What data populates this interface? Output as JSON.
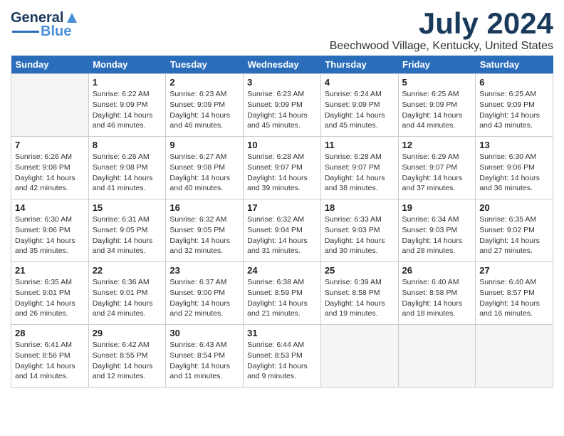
{
  "header": {
    "logo_general": "General",
    "logo_blue": "Blue",
    "month_title": "July 2024",
    "location": "Beechwood Village, Kentucky, United States"
  },
  "weekdays": [
    "Sunday",
    "Monday",
    "Tuesday",
    "Wednesday",
    "Thursday",
    "Friday",
    "Saturday"
  ],
  "weeks": [
    [
      {
        "day": "",
        "info": ""
      },
      {
        "day": "1",
        "info": "Sunrise: 6:22 AM\nSunset: 9:09 PM\nDaylight: 14 hours\nand 46 minutes."
      },
      {
        "day": "2",
        "info": "Sunrise: 6:23 AM\nSunset: 9:09 PM\nDaylight: 14 hours\nand 46 minutes."
      },
      {
        "day": "3",
        "info": "Sunrise: 6:23 AM\nSunset: 9:09 PM\nDaylight: 14 hours\nand 45 minutes."
      },
      {
        "day": "4",
        "info": "Sunrise: 6:24 AM\nSunset: 9:09 PM\nDaylight: 14 hours\nand 45 minutes."
      },
      {
        "day": "5",
        "info": "Sunrise: 6:25 AM\nSunset: 9:09 PM\nDaylight: 14 hours\nand 44 minutes."
      },
      {
        "day": "6",
        "info": "Sunrise: 6:25 AM\nSunset: 9:09 PM\nDaylight: 14 hours\nand 43 minutes."
      }
    ],
    [
      {
        "day": "7",
        "info": "Sunrise: 6:26 AM\nSunset: 9:08 PM\nDaylight: 14 hours\nand 42 minutes."
      },
      {
        "day": "8",
        "info": "Sunrise: 6:26 AM\nSunset: 9:08 PM\nDaylight: 14 hours\nand 41 minutes."
      },
      {
        "day": "9",
        "info": "Sunrise: 6:27 AM\nSunset: 9:08 PM\nDaylight: 14 hours\nand 40 minutes."
      },
      {
        "day": "10",
        "info": "Sunrise: 6:28 AM\nSunset: 9:07 PM\nDaylight: 14 hours\nand 39 minutes."
      },
      {
        "day": "11",
        "info": "Sunrise: 6:28 AM\nSunset: 9:07 PM\nDaylight: 14 hours\nand 38 minutes."
      },
      {
        "day": "12",
        "info": "Sunrise: 6:29 AM\nSunset: 9:07 PM\nDaylight: 14 hours\nand 37 minutes."
      },
      {
        "day": "13",
        "info": "Sunrise: 6:30 AM\nSunset: 9:06 PM\nDaylight: 14 hours\nand 36 minutes."
      }
    ],
    [
      {
        "day": "14",
        "info": "Sunrise: 6:30 AM\nSunset: 9:06 PM\nDaylight: 14 hours\nand 35 minutes."
      },
      {
        "day": "15",
        "info": "Sunrise: 6:31 AM\nSunset: 9:05 PM\nDaylight: 14 hours\nand 34 minutes."
      },
      {
        "day": "16",
        "info": "Sunrise: 6:32 AM\nSunset: 9:05 PM\nDaylight: 14 hours\nand 32 minutes."
      },
      {
        "day": "17",
        "info": "Sunrise: 6:32 AM\nSunset: 9:04 PM\nDaylight: 14 hours\nand 31 minutes."
      },
      {
        "day": "18",
        "info": "Sunrise: 6:33 AM\nSunset: 9:03 PM\nDaylight: 14 hours\nand 30 minutes."
      },
      {
        "day": "19",
        "info": "Sunrise: 6:34 AM\nSunset: 9:03 PM\nDaylight: 14 hours\nand 28 minutes."
      },
      {
        "day": "20",
        "info": "Sunrise: 6:35 AM\nSunset: 9:02 PM\nDaylight: 14 hours\nand 27 minutes."
      }
    ],
    [
      {
        "day": "21",
        "info": "Sunrise: 6:35 AM\nSunset: 9:01 PM\nDaylight: 14 hours\nand 26 minutes."
      },
      {
        "day": "22",
        "info": "Sunrise: 6:36 AM\nSunset: 9:01 PM\nDaylight: 14 hours\nand 24 minutes."
      },
      {
        "day": "23",
        "info": "Sunrise: 6:37 AM\nSunset: 9:00 PM\nDaylight: 14 hours\nand 22 minutes."
      },
      {
        "day": "24",
        "info": "Sunrise: 6:38 AM\nSunset: 8:59 PM\nDaylight: 14 hours\nand 21 minutes."
      },
      {
        "day": "25",
        "info": "Sunrise: 6:39 AM\nSunset: 8:58 PM\nDaylight: 14 hours\nand 19 minutes."
      },
      {
        "day": "26",
        "info": "Sunrise: 6:40 AM\nSunset: 8:58 PM\nDaylight: 14 hours\nand 18 minutes."
      },
      {
        "day": "27",
        "info": "Sunrise: 6:40 AM\nSunset: 8:57 PM\nDaylight: 14 hours\nand 16 minutes."
      }
    ],
    [
      {
        "day": "28",
        "info": "Sunrise: 6:41 AM\nSunset: 8:56 PM\nDaylight: 14 hours\nand 14 minutes."
      },
      {
        "day": "29",
        "info": "Sunrise: 6:42 AM\nSunset: 8:55 PM\nDaylight: 14 hours\nand 12 minutes."
      },
      {
        "day": "30",
        "info": "Sunrise: 6:43 AM\nSunset: 8:54 PM\nDaylight: 14 hours\nand 11 minutes."
      },
      {
        "day": "31",
        "info": "Sunrise: 6:44 AM\nSunset: 8:53 PM\nDaylight: 14 hours\nand 9 minutes."
      },
      {
        "day": "",
        "info": ""
      },
      {
        "day": "",
        "info": ""
      },
      {
        "day": "",
        "info": ""
      }
    ]
  ]
}
